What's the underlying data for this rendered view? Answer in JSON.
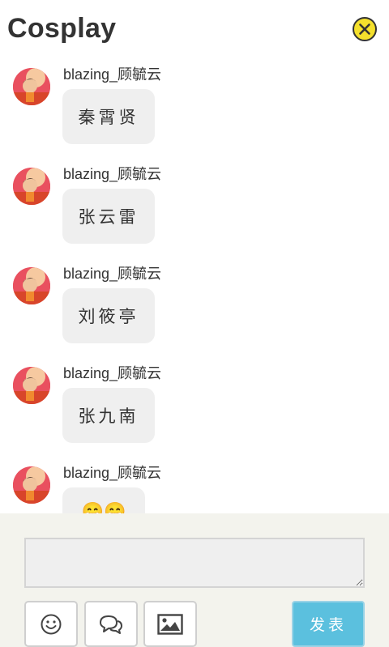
{
  "header": {
    "title": "Cosplay",
    "close_icon": "close-circle-icon"
  },
  "messages": [
    {
      "username": "blazing_顾毓云",
      "text": "秦霄贤"
    },
    {
      "username": "blazing_顾毓云",
      "text": "张云雷"
    },
    {
      "username": "blazing_顾毓云",
      "text": "刘筱亭"
    },
    {
      "username": "blazing_顾毓云",
      "text": "张九南"
    },
    {
      "username": "blazing_顾毓云",
      "text": "😁😁"
    }
  ],
  "composer": {
    "input_value": "",
    "placeholder": "",
    "tools": [
      {
        "icon": "emoji-smile-icon"
      },
      {
        "icon": "chat-bubbles-icon"
      },
      {
        "icon": "image-icon"
      }
    ],
    "send_label": "发表"
  },
  "colors": {
    "close_yellow": "#f4e02c",
    "send_button": "#5bc0de",
    "bubble": "#efefef",
    "panel": "#f3f3ed"
  }
}
